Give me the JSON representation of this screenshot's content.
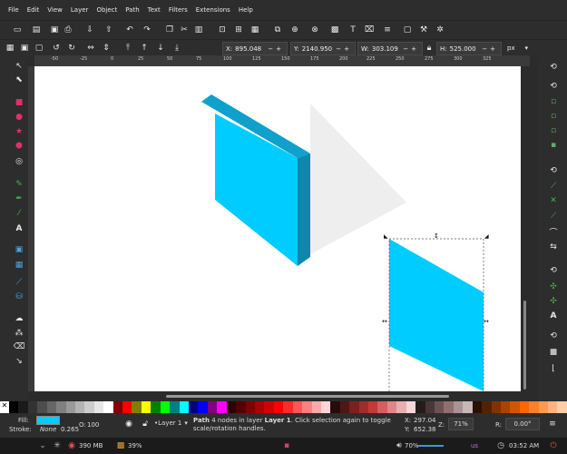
{
  "menu": [
    "File",
    "Edit",
    "View",
    "Layer",
    "Object",
    "Path",
    "Text",
    "Filters",
    "Extensions",
    "Help"
  ],
  "coords": {
    "x_label": "X:",
    "x_value": "895.048",
    "y_label": "Y:",
    "y_value": "2140.950",
    "w_label": "W:",
    "w_value": "303.109",
    "h_label": "H:",
    "h_value": "525.000",
    "unit": "px"
  },
  "ruler_ticks": [
    "-50",
    "-25",
    "0",
    "25",
    "50",
    "75",
    "100",
    "125",
    "150",
    "175",
    "200",
    "225",
    "250",
    "275",
    "300",
    "325"
  ],
  "status": {
    "fill_label": "Fill:",
    "stroke_label": "Stroke:",
    "stroke_value": "None",
    "stroke_width": "0.265",
    "opacity_label": "O:",
    "opacity_value": "100",
    "layer_name": "•Layer 1",
    "message_bold": "Path",
    "message_text": " 4 nodes in layer ",
    "message_layer": "Layer 1",
    "message_rest": ". Click selection again to toggle scale/rotation handles.",
    "cursor_x_label": "X:",
    "cursor_x": "297.04",
    "cursor_y_label": "Y:",
    "cursor_y": "652.38",
    "zoom_label": "Z:",
    "zoom": "71%",
    "rotate_label": "R:",
    "rotate": "0.00°",
    "fill_color": "#00ccff"
  },
  "taskbar": {
    "mem": "390 MB",
    "cpu": "39%",
    "volume": "70%",
    "layout": "us",
    "time": "03:52 AM"
  },
  "colors": {
    "cyan": "#00ccff",
    "dark_cyan": "#0e87ab",
    "mid_cyan": "#0fa0cc",
    "shadow": "#eeeeee"
  }
}
